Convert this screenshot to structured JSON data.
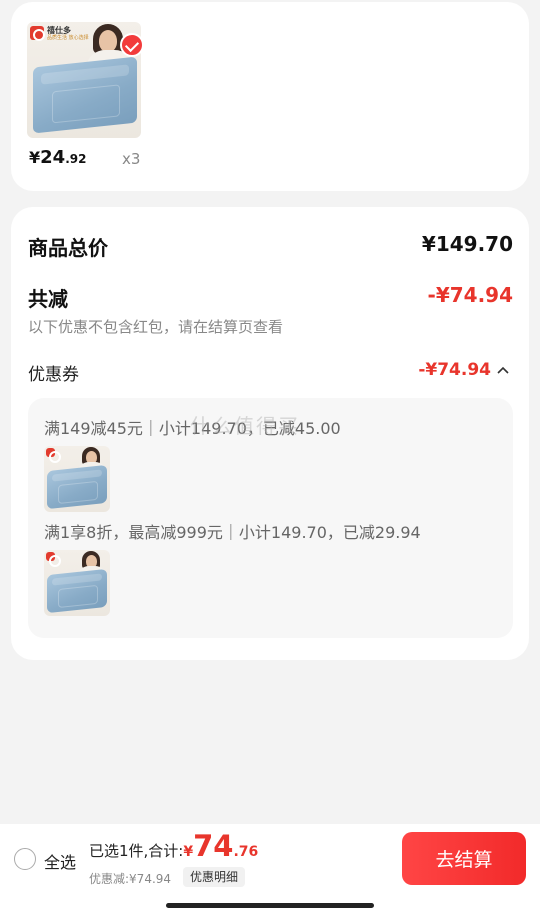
{
  "selected_item": {
    "price_symbol": "¥",
    "price_int": "24",
    "price_dec": ".92",
    "quantity": "x3",
    "brand": "禧仕多",
    "brand_sub": "品质生活 放心选择"
  },
  "summary": {
    "total_label": "商品总价",
    "total_value": "¥149.70",
    "discount_label": "共减",
    "discount_value": "-¥74.94",
    "discount_note": "以下优惠不包含红包，请在结算页查看",
    "coupon_label": "优惠券",
    "coupon_value": "-¥74.94",
    "coupons": [
      {
        "text": "满149减45元｜小计149.70，已减45.00"
      },
      {
        "text": "满1享8折，最高减999元｜小计149.70，已减29.94"
      }
    ],
    "watermark": "什么值得买"
  },
  "bottom_bar": {
    "select_all": "全选",
    "selected_text": "已选1件,合计:",
    "total_symbol": "¥",
    "total_int": "74",
    "total_dec": ".76",
    "discount_text": "优惠减:¥74.94",
    "detail_button": "优惠明细",
    "checkout_button": "去结算"
  },
  "colors": {
    "accent": "#f23b3b",
    "discount_red": "#e8352c",
    "background": "#f3f3f3"
  }
}
